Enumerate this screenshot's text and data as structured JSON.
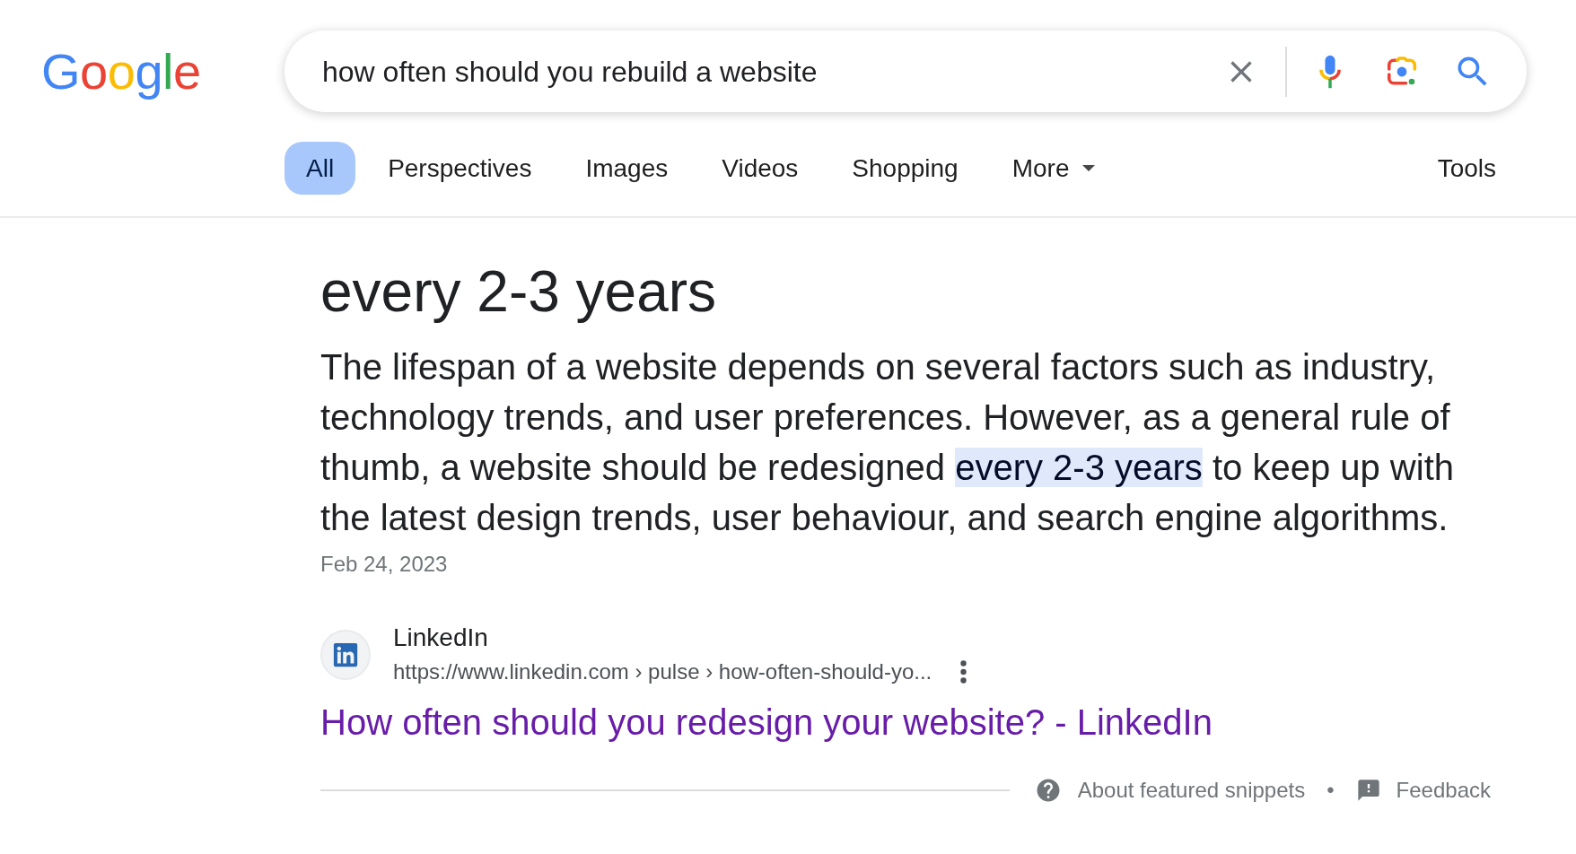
{
  "logo": {
    "text": "Google"
  },
  "search": {
    "value": "how often should you rebuild a website"
  },
  "tabs": [
    {
      "label": "All",
      "selected": true,
      "kind": "tab"
    },
    {
      "label": "Perspectives",
      "selected": false,
      "kind": "tab"
    },
    {
      "label": "Images",
      "selected": false,
      "kind": "tab"
    },
    {
      "label": "Videos",
      "selected": false,
      "kind": "tab"
    },
    {
      "label": "Shopping",
      "selected": false,
      "kind": "tab"
    },
    {
      "label": "More",
      "selected": false,
      "kind": "menu"
    }
  ],
  "tools": {
    "label": "Tools"
  },
  "featured_snippet": {
    "heading": "every 2-3 years",
    "body": [
      {
        "text": "The lifespan of a website depends on several factors such as industry, technology trends, and user preferences. However, as a general rule of thumb, a website should be redesigned ",
        "highlighted": false
      },
      {
        "text": "every 2-3 years",
        "highlighted": true
      },
      {
        "text": " to keep up with the latest design trends, user behaviour, and search engine algorithms.",
        "highlighted": false
      }
    ],
    "date": "Feb 24, 2023",
    "source": {
      "name": "LinkedIn",
      "url": "https://www.linkedin.com › pulse › how-often-should-yo..."
    },
    "title": "How often should you redesign your website? - LinkedIn"
  },
  "footer": {
    "about": "About featured snippets",
    "separator": "•",
    "feedback": "Feedback"
  }
}
